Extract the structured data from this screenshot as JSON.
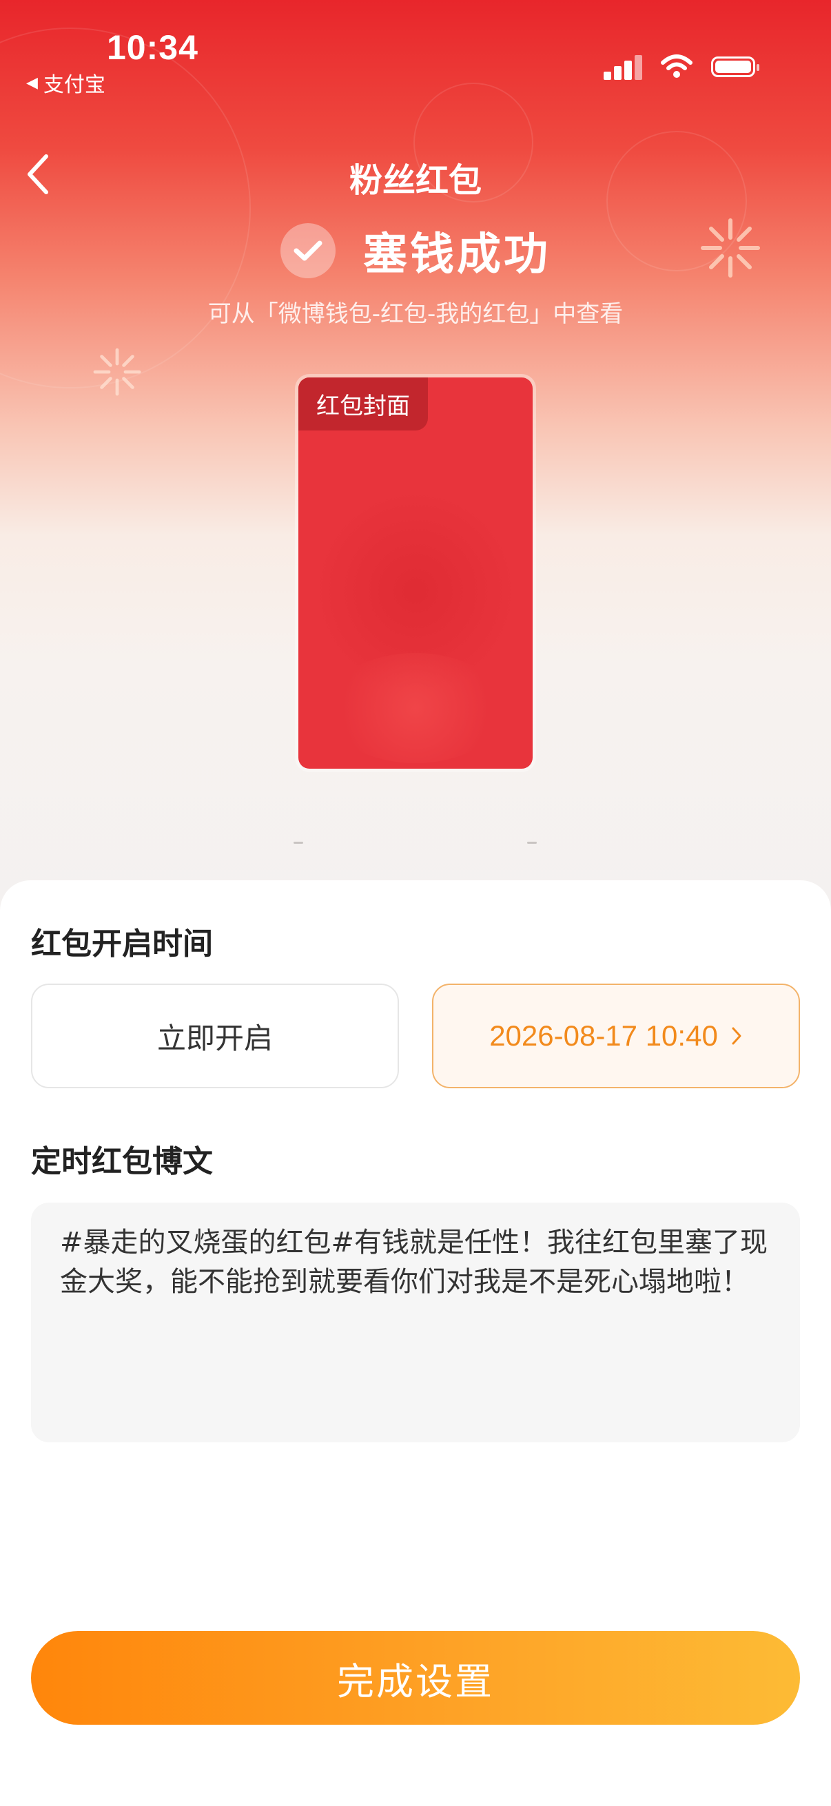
{
  "status_bar": {
    "time": "10:34",
    "back_app_label": "支付宝"
  },
  "header": {
    "title": "粉丝红包"
  },
  "success": {
    "title": "塞钱成功",
    "hint": "可从「微博钱包-红包-我的红包」中查看"
  },
  "cover": {
    "tag": "红包封面",
    "color": "#e8343c"
  },
  "open_time": {
    "label": "红包开启时间",
    "option_now": "立即开启",
    "option_scheduled": "2026-08-17 10:40",
    "selected": "option_scheduled"
  },
  "post": {
    "label": "定时红包博文",
    "text": "#暴走的叉烧蛋的红包#有钱就是任性！我往红包里塞了现金大奖，能不能抢到就要看你们对我是不是死心塌地啦！"
  },
  "footer": {
    "done_label": "完成设置"
  },
  "icons": {
    "back": "chevron-left-icon",
    "check": "check-icon",
    "chevron": "chevron-right-icon",
    "wifi": "wifi-icon",
    "battery": "battery-icon",
    "signal": "signal-icon"
  },
  "colors": {
    "brand_red": "#e8262b",
    "accent_orange": "#f28a1c",
    "button_gradient_start": "#ff860b",
    "button_gradient_end": "#fdbb35"
  }
}
